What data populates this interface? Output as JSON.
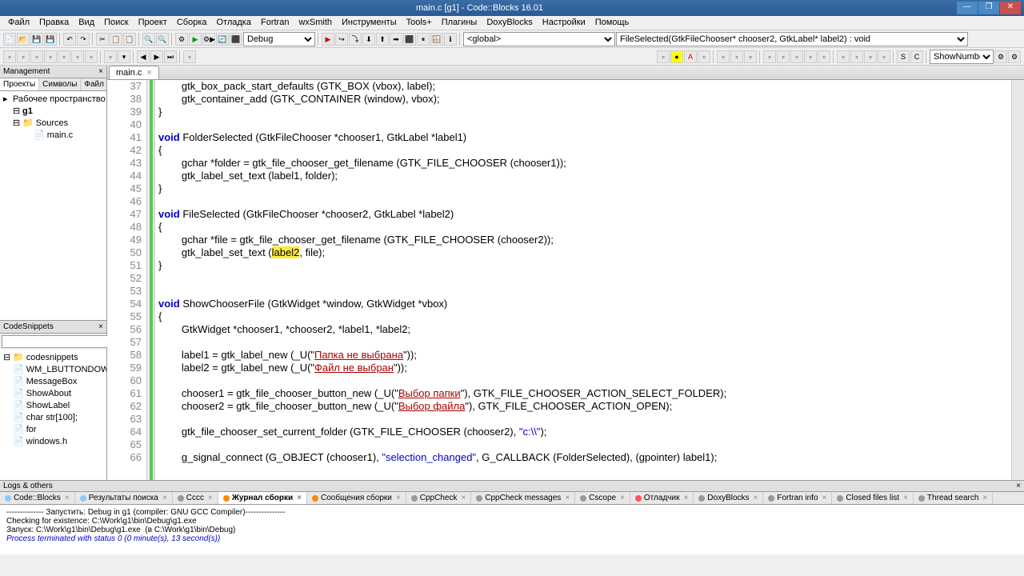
{
  "window": {
    "title": "main.c [g1] - Code::Blocks 16.01"
  },
  "menu": [
    "Файл",
    "Правка",
    "Вид",
    "Поиск",
    "Проект",
    "Сборка",
    "Отладка",
    "Fortran",
    "wxSmith",
    "Инструменты",
    "Tools+",
    "Плагины",
    "DoxyBlocks",
    "Настройки",
    "Помощь"
  ],
  "toolbar": {
    "config": "Debug",
    "scope": "<global>",
    "symbol": "FileSelected(GtkFileChooser* chooser2, GtkLabel* label2) : void",
    "show": "ShowNumber"
  },
  "management": {
    "title": "Management",
    "tabs": [
      "Проекты",
      "Символы",
      "Файл"
    ],
    "workspace": "Рабочее пространство",
    "project": "g1",
    "folder": "Sources",
    "file": "main.c"
  },
  "snippets": {
    "title": "CodeSnippets",
    "root": "codesnippets",
    "items": [
      "WM_LBUTTONDOWN",
      "MessageBox",
      "ShowAbout",
      "ShowLabel",
      "char str[100];",
      "for",
      "windows.h"
    ]
  },
  "editor": {
    "tab": "main.c",
    "lines": [
      {
        "n": 37,
        "t": "        gtk_box_pack_start_defaults (GTK_BOX (vbox), label);"
      },
      {
        "n": 38,
        "t": "        gtk_container_add (GTK_CONTAINER (window), vbox);"
      },
      {
        "n": 39,
        "t": "}"
      },
      {
        "n": 40,
        "t": ""
      },
      {
        "n": 41,
        "t": "void FolderSelected (GtkFileChooser *chooser1, GtkLabel *label1)",
        "kw": "void"
      },
      {
        "n": 42,
        "t": "{"
      },
      {
        "n": 43,
        "t": "        gchar *folder = gtk_file_chooser_get_filename (GTK_FILE_CHOOSER (chooser1));"
      },
      {
        "n": 44,
        "t": "        gtk_label_set_text (label1, folder);"
      },
      {
        "n": 45,
        "t": "}"
      },
      {
        "n": 46,
        "t": ""
      },
      {
        "n": 47,
        "t": "void FileSelected (GtkFileChooser *chooser2, GtkLabel *label2)",
        "kw": "void"
      },
      {
        "n": 48,
        "t": "{"
      },
      {
        "n": 49,
        "t": "        gchar *file = gtk_file_chooser_get_filename (GTK_FILE_CHOOSER (chooser2));"
      },
      {
        "n": 50,
        "t": "        gtk_label_set_text (label2, file);",
        "hl": "label2"
      },
      {
        "n": 51,
        "t": "}"
      },
      {
        "n": 52,
        "t": ""
      },
      {
        "n": 53,
        "t": ""
      },
      {
        "n": 54,
        "t": "void ShowChooserFile (GtkWidget *window, GtkWidget *vbox)",
        "kw": "void"
      },
      {
        "n": 55,
        "t": "{"
      },
      {
        "n": 56,
        "t": "        GtkWidget *chooser1, *chooser2, *label1, *label2;"
      },
      {
        "n": 57,
        "t": ""
      },
      {
        "n": 58,
        "t": "        label1 = gtk_label_new (_U(\"Папка не выбрана\"));",
        "rs": "Папка не выбрана"
      },
      {
        "n": 59,
        "t": "        label2 = gtk_label_new (_U(\"Файл не выбран\"));",
        "rs": "Файл не выбран"
      },
      {
        "n": 60,
        "t": ""
      },
      {
        "n": 61,
        "t": "        chooser1 = gtk_file_chooser_button_new (_U(\"Выбор папки\"), GTK_FILE_CHOOSER_ACTION_SELECT_FOLDER);",
        "rs": "Выбор папки"
      },
      {
        "n": 62,
        "t": "        chooser2 = gtk_file_chooser_button_new (_U(\"Выбор файла\"), GTK_FILE_CHOOSER_ACTION_OPEN);",
        "rs": "Выбор файла"
      },
      {
        "n": 63,
        "t": ""
      },
      {
        "n": 64,
        "t": "        gtk_file_chooser_set_current_folder (GTK_FILE_CHOOSER (chooser2), \"c:\\\\\");",
        "str": "c:\\\\"
      },
      {
        "n": 65,
        "t": ""
      },
      {
        "n": 66,
        "t": "        g_signal_connect (G_OBJECT (chooser1), \"selection_changed\", G_CALLBACK (FolderSelected), (gpointer) label1);",
        "str": "selection_changed"
      }
    ]
  },
  "logs": {
    "title": "Logs & others",
    "tabs": [
      "Code::Blocks",
      "Результаты поиска",
      "Cccc",
      "Журнал сборки",
      "Сообщения сборки",
      "CppCheck",
      "CppCheck messages",
      "Cscope",
      "Отладчик",
      "DoxyBlocks",
      "Fortran info",
      "Closed files list",
      "Thread search"
    ],
    "active": 3,
    "lines": [
      "-------------- Запустить: Debug in g1 (compiler: GNU GCC Compiler)---------------",
      "Checking for existence: C:\\Work\\g1\\bin\\Debug\\g1.exe",
      "Запуск: C:\\Work\\g1\\bin\\Debug\\g1.exe  (в C:\\Work\\g1\\bin\\Debug)",
      "Process terminated with status 0 (0 minute(s), 13 second(s))"
    ]
  }
}
